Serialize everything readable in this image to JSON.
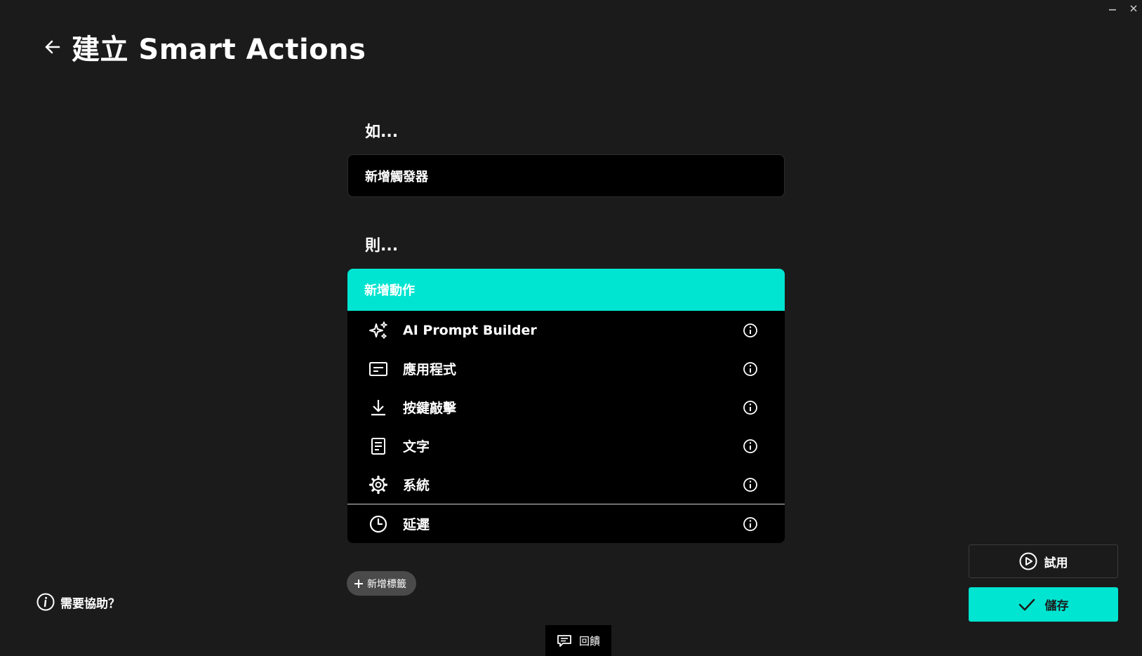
{
  "window": {
    "minimize_symbol": "–",
    "close_symbol": "✕"
  },
  "header": {
    "title": "建立 Smart Actions",
    "back_icon": "arrow-left-icon"
  },
  "if_section": {
    "label": "如...",
    "trigger_placeholder": "新增觸發器"
  },
  "then_section": {
    "label": "則...",
    "add_action_label": "新增動作",
    "actions": [
      {
        "label": "AI Prompt Builder",
        "icon": "sparkle-icon"
      },
      {
        "label": "應用程式",
        "icon": "application-window-icon"
      },
      {
        "label": "按鍵敲擊",
        "icon": "download-arrow-icon"
      },
      {
        "label": "文字",
        "icon": "document-icon"
      },
      {
        "label": "系統",
        "icon": "gear-icon"
      },
      {
        "label": "延遲",
        "icon": "clock-icon"
      }
    ]
  },
  "add_tag": {
    "label": "新增標籤"
  },
  "help": {
    "label": "需要協助？"
  },
  "feedback": {
    "label": "回饋"
  },
  "buttons": {
    "try_label": "試用",
    "save_label": "儲存"
  },
  "colors": {
    "accent": "#00e5d1",
    "background": "#1b1b1b",
    "panel": "#000000"
  }
}
